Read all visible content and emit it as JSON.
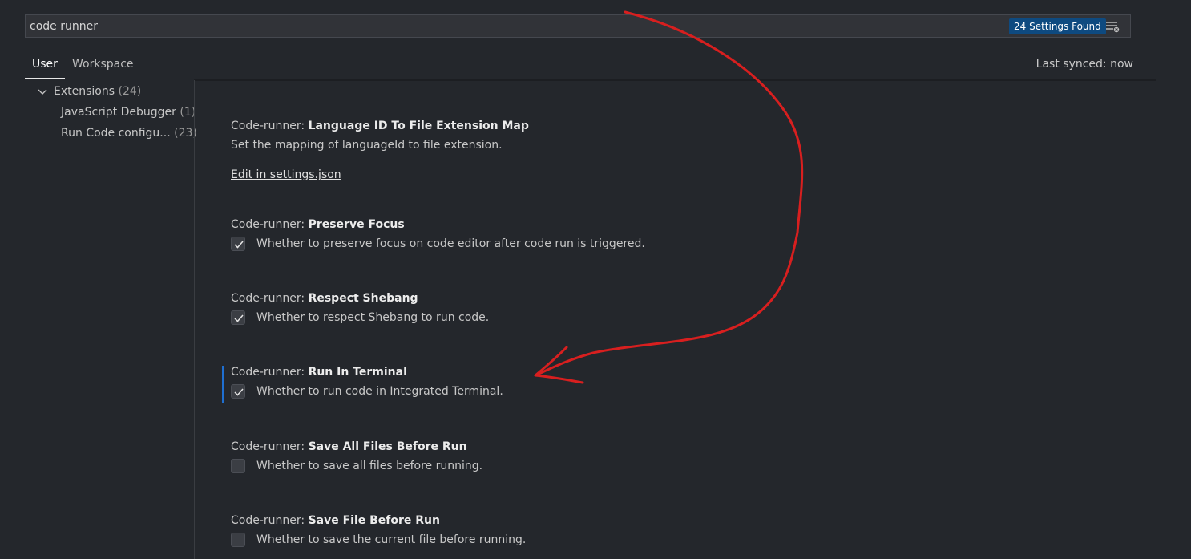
{
  "search": {
    "value": "code runner",
    "results_badge": "24 Settings Found",
    "filter_icon": "filter-list-icon"
  },
  "tabs": [
    {
      "label": "User",
      "active": true
    },
    {
      "label": "Workspace",
      "active": false
    }
  ],
  "sync_status": "Last synced: now",
  "toc": {
    "group": {
      "label": "Extensions",
      "count": "(24)",
      "icon": "chevron-down-icon"
    },
    "items": [
      {
        "label": "JavaScript Debugger",
        "count": "(1)"
      },
      {
        "label": "Run Code configu...",
        "count": "(23)"
      }
    ]
  },
  "settings": [
    {
      "category": "Code-runner: ",
      "name": "Language ID To File Extension Map",
      "description": "Set the mapping of languageId to file extension.",
      "link": "Edit in settings.json"
    },
    {
      "category": "Code-runner: ",
      "name": "Preserve Focus",
      "description": "Whether to preserve focus on code editor after code run is triggered.",
      "checked": true
    },
    {
      "category": "Code-runner: ",
      "name": "Respect Shebang",
      "description": "Whether to respect Shebang to run code.",
      "checked": true
    },
    {
      "category": "Code-runner: ",
      "name": "Run In Terminal",
      "description": "Whether to run code in Integrated Terminal.",
      "checked": true,
      "focused": true
    },
    {
      "category": "Code-runner: ",
      "name": "Save All Files Before Run",
      "description": "Whether to save all files before running.",
      "checked": false
    },
    {
      "category": "Code-runner: ",
      "name": "Save File Before Run",
      "description": "Whether to save the current file before running.",
      "checked": false
    }
  ],
  "colors": {
    "background": "#24272c",
    "badge": "#0e4a80",
    "focus_bar": "#1f6fd1",
    "annotation_arrow": "#d81f1f"
  }
}
